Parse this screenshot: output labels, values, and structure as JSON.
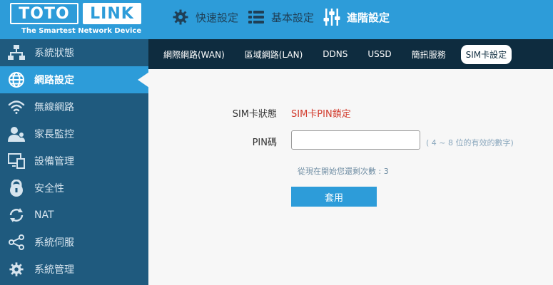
{
  "brand": {
    "logo_left": "TOTO",
    "logo_right": "LINK",
    "tagline": "The Smartest Network Device",
    "header_color": "#2d9cd9"
  },
  "top_nav": [
    {
      "label": "快速設定",
      "icon": "gear-icon"
    },
    {
      "label": "基本設定",
      "icon": "list-icon"
    },
    {
      "label": "進階設定",
      "icon": "sliders-icon",
      "active": true
    }
  ],
  "sidebar": {
    "items": [
      {
        "label": "系統狀態",
        "icon": "network-status-icon"
      },
      {
        "label": "網路設定",
        "icon": "globe-icon",
        "active": true
      },
      {
        "label": "無線網路",
        "icon": "wifi-icon"
      },
      {
        "label": "家長監控",
        "icon": "parental-control-icon"
      },
      {
        "label": "設備管理",
        "icon": "device-management-icon"
      },
      {
        "label": "安全性",
        "icon": "lock-icon"
      },
      {
        "label": "NAT",
        "icon": "refresh-icon"
      },
      {
        "label": "系統伺服",
        "icon": "share-icon"
      },
      {
        "label": "系統管理",
        "icon": "gear-icon"
      }
    ]
  },
  "subnav": {
    "tabs": [
      {
        "label": "網際網路(WAN)"
      },
      {
        "label": "區域網路(LAN)"
      },
      {
        "label": "DDNS"
      },
      {
        "label": "USSD"
      },
      {
        "label": "簡訊服務"
      },
      {
        "label": "SIM卡設定",
        "active": true
      }
    ]
  },
  "form": {
    "sim_status_label": "SIM卡狀態",
    "sim_status_value": "SIM卡PIN鎖定",
    "pin_label": "PIN碼",
    "pin_value": "",
    "pin_hint": "( 4 ~ 8 位的有效的數字)",
    "retry_text": "從現在開始您還剩次數 :   3",
    "apply_label": "套用"
  }
}
